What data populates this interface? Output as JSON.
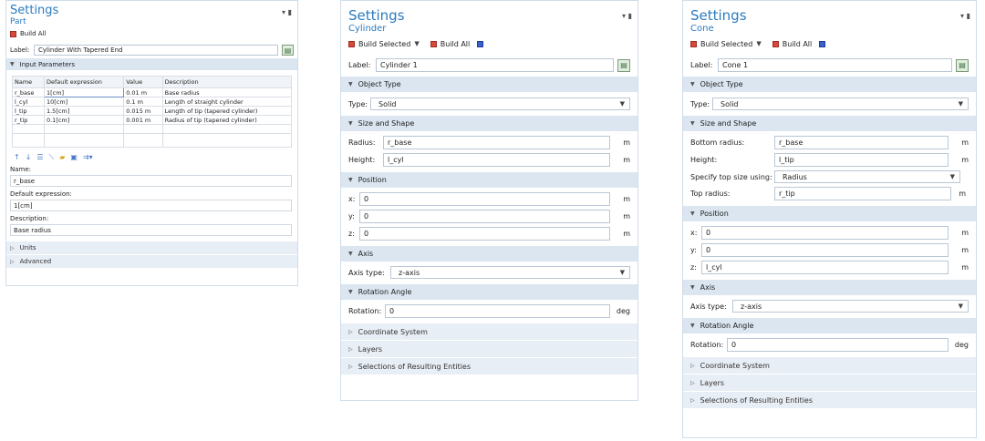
{
  "panel1": {
    "title": "Settings",
    "subtitle": "Part",
    "build_all": "Build All",
    "label_caption": "Label:",
    "label_value": "Cylinder With Tapered End",
    "input_params_section": "Input Parameters",
    "table": {
      "columns": [
        "Name",
        "Default expression",
        "Value",
        "Description"
      ],
      "rows": [
        [
          "r_base",
          "1[cm]",
          "0.01 m",
          "Base radius"
        ],
        [
          "l_cyl",
          "10[cm]",
          "0.1 m",
          "Length of straight cylinder"
        ],
        [
          "l_tip",
          "1.5[cm]",
          "0.015 m",
          "Length of tip (tapered cylinder)"
        ],
        [
          "r_tip",
          "0.1[cm]",
          "0.001 m",
          "Radius of tip (tapered cylinder)"
        ]
      ]
    },
    "toolbar_icons": [
      "arrow-up-icon",
      "arrow-down-icon",
      "list-icon",
      "clear-icon",
      "folder-open-icon",
      "save-icon",
      "import-icon"
    ],
    "name_label": "Name:",
    "name_value": "r_base",
    "default_expr_label": "Default expression:",
    "default_expr_value": "1[cm]",
    "description_label": "Description:",
    "description_value": "Base radius",
    "units_section": "Units",
    "advanced_section": "Advanced"
  },
  "panel2": {
    "title": "Settings",
    "subtitle": "Cylinder",
    "build_selected": "Build Selected",
    "build_all": "Build All",
    "label_caption": "Label:",
    "label_value": "Cylinder 1",
    "object_type_section": "Object Type",
    "type_label": "Type:",
    "type_value": "Solid",
    "size_shape_section": "Size and Shape",
    "radius_label": "Radius:",
    "radius_value": "r_base",
    "radius_unit": "m",
    "height_label": "Height:",
    "height_value": "l_cyl",
    "height_unit": "m",
    "position_section": "Position",
    "x_label": "x:",
    "x_value": "0",
    "x_unit": "m",
    "y_label": "y:",
    "y_value": "0",
    "y_unit": "m",
    "z_label": "z:",
    "z_value": "0",
    "z_unit": "m",
    "axis_section": "Axis",
    "axis_type_label": "Axis type:",
    "axis_type_value": "z-axis",
    "rotation_section": "Rotation Angle",
    "rotation_label": "Rotation:",
    "rotation_value": "0",
    "rotation_unit": "deg",
    "coord_section": "Coordinate System",
    "layers_section": "Layers",
    "selections_section": "Selections of Resulting Entities"
  },
  "panel3": {
    "title": "Settings",
    "subtitle": "Cone",
    "build_selected": "Build Selected",
    "build_all": "Build All",
    "label_caption": "Label:",
    "label_value": "Cone 1",
    "object_type_section": "Object Type",
    "type_label": "Type:",
    "type_value": "Solid",
    "size_shape_section": "Size and Shape",
    "bottom_radius_label": "Bottom radius:",
    "bottom_radius_value": "r_base",
    "bottom_radius_unit": "m",
    "height_label": "Height:",
    "height_value": "l_tip",
    "height_unit": "m",
    "top_size_label": "Specify top size using:",
    "top_size_value": "Radius",
    "top_radius_label": "Top radius:",
    "top_radius_value": "r_tip",
    "top_radius_unit": "m",
    "position_section": "Position",
    "x_label": "x:",
    "x_value": "0",
    "x_unit": "m",
    "y_label": "y:",
    "y_value": "0",
    "y_unit": "m",
    "z_label": "z:",
    "z_value": "l_cyl",
    "z_unit": "m",
    "axis_section": "Axis",
    "axis_type_label": "Axis type:",
    "axis_type_value": "z-axis",
    "rotation_section": "Rotation Angle",
    "rotation_label": "Rotation:",
    "rotation_value": "0",
    "rotation_unit": "deg",
    "coord_section": "Coordinate System",
    "layers_section": "Layers",
    "selections_section": "Selections of Resulting Entities"
  }
}
